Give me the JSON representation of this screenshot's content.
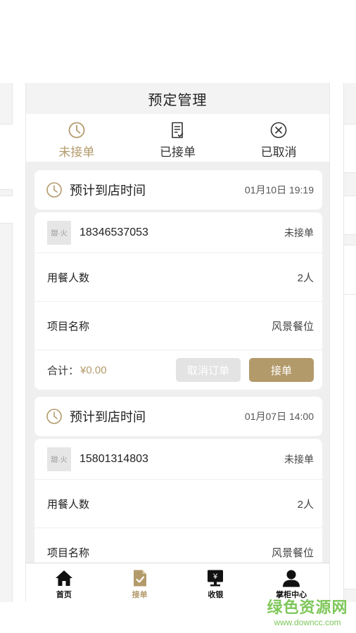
{
  "navbar": {
    "title": "预定管理"
  },
  "tabs": [
    {
      "label": "未接单",
      "icon": "clock-icon",
      "active": true
    },
    {
      "label": "已接单",
      "icon": "document-check-icon",
      "active": false
    },
    {
      "label": "已取消",
      "icon": "circle-x-icon",
      "active": false
    }
  ],
  "orders": [
    {
      "arrival_label": "预计到店时间",
      "arrival_time": "01月10日 19:19",
      "logo_text": "甜·火",
      "phone": "18346537053",
      "status": "未接单",
      "guests_label": "用餐人数",
      "guests_value": "2人",
      "item_label": "项目名称",
      "item_value": "风景餐位",
      "total_label": "合计：",
      "total_value": "¥0.00",
      "cancel_label": "取消订单",
      "accept_label": "接单"
    },
    {
      "arrival_label": "预计到店时间",
      "arrival_time": "01月07日 14:00",
      "logo_text": "甜·火",
      "phone": "15801314803",
      "status": "未接单",
      "guests_label": "用餐人数",
      "guests_value": "2人",
      "item_label": "项目名称",
      "item_value": "风景餐位"
    }
  ],
  "bottom_nav": [
    {
      "label": "首页",
      "icon": "home-icon",
      "active": false
    },
    {
      "label": "接单",
      "icon": "order-accept-icon",
      "active": true
    },
    {
      "label": "收银",
      "icon": "cashier-icon",
      "active": false
    },
    {
      "label": "掌柜中心",
      "icon": "user-icon",
      "active": false
    }
  ],
  "watermark": {
    "text": "绿色资源网",
    "url": "www.downcc.com"
  },
  "colors": {
    "accent": "#b39a6b",
    "background": "#efefef",
    "watermark": "#7ec75a"
  }
}
